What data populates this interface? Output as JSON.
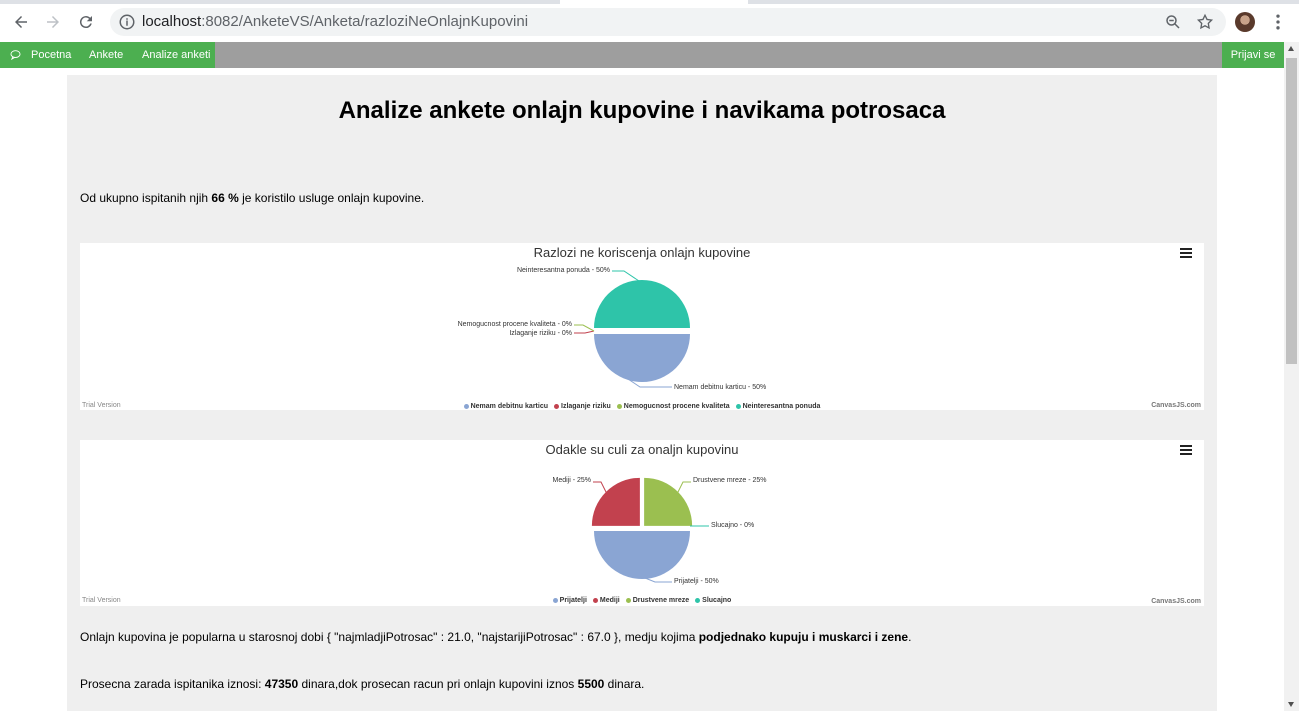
{
  "browser": {
    "url_host": "localhost",
    "url_path": ":8082/AnketeVS/Anketa/razloziNeOnlajnKupovini"
  },
  "navbar": {
    "items": [
      {
        "label": "Pocetna"
      },
      {
        "label": "Ankete"
      },
      {
        "label": "Analize anketi"
      }
    ],
    "login_label": "Prijavi se",
    "colors": {
      "accent": "#4caf50",
      "bar": "#9e9e9e"
    }
  },
  "page": {
    "title": "Analize ankete onlajn kupovine i navikama potrosaca",
    "summary_pre": "Od ukupno ispitanih njih ",
    "summary_bold": "66 %",
    "summary_post": " je koristilo usluge onlajn kupovine.",
    "age_pre": "Onlajn kupovina je popularna u starosnoj dobi { \"najmladjiPotrosac\" : 21.0, \"najstarijiPotrosac\" : 67.0 }, medju kojima ",
    "age_bold": "podjednako kupuju i muskarci i zene",
    "age_post": ".",
    "income_pre": "Prosecna zarada ispitanika iznosi: ",
    "income_bold1": "47350",
    "income_mid": " dinara,dok prosecan racun pri onlajn kupovini iznos ",
    "income_bold2": "5500",
    "income_post": " dinara."
  },
  "chart_meta": {
    "trial_label": "Trial Version",
    "credit_label": "CanvasJS.com"
  },
  "chart_data": [
    {
      "type": "pie",
      "title": "Razlozi ne koriscenja onlajn kupovine",
      "categories": [
        "Nemam debitnu karticu",
        "Izlaganje riziku",
        "Nemogucnost procene kvaliteta",
        "Neinteresantna ponuda"
      ],
      "values": [
        50,
        0,
        0,
        50
      ],
      "point_labels": [
        "Nemam debitnu karticu - 50%",
        "Izlaganje riziku - 0%",
        "Nemogucnost procene kvaliteta - 0%",
        "Neinteresantna ponuda - 50%"
      ],
      "colors": [
        "#8aa5d3",
        "#c2414e",
        "#9bbf50",
        "#2ec4a9"
      ],
      "legend": "bottom"
    },
    {
      "type": "pie",
      "title": "Odakle su culi za onaljn kupovinu",
      "categories": [
        "Prijatelji",
        "Mediji",
        "Drustvene mreze",
        "Slucajno"
      ],
      "values": [
        50,
        25,
        25,
        0
      ],
      "point_labels": [
        "Prijatelji - 50%",
        "Mediji - 25%",
        "Drustvene mreze - 25%",
        "Slucajno - 0%"
      ],
      "colors": [
        "#8aa5d3",
        "#c2414e",
        "#9bbf50",
        "#2ec4a9"
      ],
      "legend": "bottom"
    }
  ]
}
